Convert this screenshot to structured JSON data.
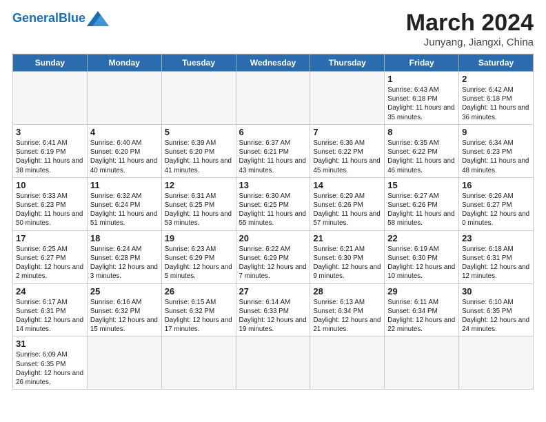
{
  "header": {
    "logo_general": "General",
    "logo_blue": "Blue",
    "month_title": "March 2024",
    "subtitle": "Junyang, Jiangxi, China"
  },
  "days_of_week": [
    "Sunday",
    "Monday",
    "Tuesday",
    "Wednesday",
    "Thursday",
    "Friday",
    "Saturday"
  ],
  "weeks": [
    [
      {
        "day": "",
        "info": ""
      },
      {
        "day": "",
        "info": ""
      },
      {
        "day": "",
        "info": ""
      },
      {
        "day": "",
        "info": ""
      },
      {
        "day": "",
        "info": ""
      },
      {
        "day": "1",
        "info": "Sunrise: 6:43 AM\nSunset: 6:18 PM\nDaylight: 11 hours and 35 minutes."
      },
      {
        "day": "2",
        "info": "Sunrise: 6:42 AM\nSunset: 6:18 PM\nDaylight: 11 hours and 36 minutes."
      }
    ],
    [
      {
        "day": "3",
        "info": "Sunrise: 6:41 AM\nSunset: 6:19 PM\nDaylight: 11 hours and 38 minutes."
      },
      {
        "day": "4",
        "info": "Sunrise: 6:40 AM\nSunset: 6:20 PM\nDaylight: 11 hours and 40 minutes."
      },
      {
        "day": "5",
        "info": "Sunrise: 6:39 AM\nSunset: 6:20 PM\nDaylight: 11 hours and 41 minutes."
      },
      {
        "day": "6",
        "info": "Sunrise: 6:37 AM\nSunset: 6:21 PM\nDaylight: 11 hours and 43 minutes."
      },
      {
        "day": "7",
        "info": "Sunrise: 6:36 AM\nSunset: 6:22 PM\nDaylight: 11 hours and 45 minutes."
      },
      {
        "day": "8",
        "info": "Sunrise: 6:35 AM\nSunset: 6:22 PM\nDaylight: 11 hours and 46 minutes."
      },
      {
        "day": "9",
        "info": "Sunrise: 6:34 AM\nSunset: 6:23 PM\nDaylight: 11 hours and 48 minutes."
      }
    ],
    [
      {
        "day": "10",
        "info": "Sunrise: 6:33 AM\nSunset: 6:23 PM\nDaylight: 11 hours and 50 minutes."
      },
      {
        "day": "11",
        "info": "Sunrise: 6:32 AM\nSunset: 6:24 PM\nDaylight: 11 hours and 51 minutes."
      },
      {
        "day": "12",
        "info": "Sunrise: 6:31 AM\nSunset: 6:25 PM\nDaylight: 11 hours and 53 minutes."
      },
      {
        "day": "13",
        "info": "Sunrise: 6:30 AM\nSunset: 6:25 PM\nDaylight: 11 hours and 55 minutes."
      },
      {
        "day": "14",
        "info": "Sunrise: 6:29 AM\nSunset: 6:26 PM\nDaylight: 11 hours and 57 minutes."
      },
      {
        "day": "15",
        "info": "Sunrise: 6:27 AM\nSunset: 6:26 PM\nDaylight: 11 hours and 58 minutes."
      },
      {
        "day": "16",
        "info": "Sunrise: 6:26 AM\nSunset: 6:27 PM\nDaylight: 12 hours and 0 minutes."
      }
    ],
    [
      {
        "day": "17",
        "info": "Sunrise: 6:25 AM\nSunset: 6:27 PM\nDaylight: 12 hours and 2 minutes."
      },
      {
        "day": "18",
        "info": "Sunrise: 6:24 AM\nSunset: 6:28 PM\nDaylight: 12 hours and 3 minutes."
      },
      {
        "day": "19",
        "info": "Sunrise: 6:23 AM\nSunset: 6:29 PM\nDaylight: 12 hours and 5 minutes."
      },
      {
        "day": "20",
        "info": "Sunrise: 6:22 AM\nSunset: 6:29 PM\nDaylight: 12 hours and 7 minutes."
      },
      {
        "day": "21",
        "info": "Sunrise: 6:21 AM\nSunset: 6:30 PM\nDaylight: 12 hours and 9 minutes."
      },
      {
        "day": "22",
        "info": "Sunrise: 6:19 AM\nSunset: 6:30 PM\nDaylight: 12 hours and 10 minutes."
      },
      {
        "day": "23",
        "info": "Sunrise: 6:18 AM\nSunset: 6:31 PM\nDaylight: 12 hours and 12 minutes."
      }
    ],
    [
      {
        "day": "24",
        "info": "Sunrise: 6:17 AM\nSunset: 6:31 PM\nDaylight: 12 hours and 14 minutes."
      },
      {
        "day": "25",
        "info": "Sunrise: 6:16 AM\nSunset: 6:32 PM\nDaylight: 12 hours and 15 minutes."
      },
      {
        "day": "26",
        "info": "Sunrise: 6:15 AM\nSunset: 6:32 PM\nDaylight: 12 hours and 17 minutes."
      },
      {
        "day": "27",
        "info": "Sunrise: 6:14 AM\nSunset: 6:33 PM\nDaylight: 12 hours and 19 minutes."
      },
      {
        "day": "28",
        "info": "Sunrise: 6:13 AM\nSunset: 6:34 PM\nDaylight: 12 hours and 21 minutes."
      },
      {
        "day": "29",
        "info": "Sunrise: 6:11 AM\nSunset: 6:34 PM\nDaylight: 12 hours and 22 minutes."
      },
      {
        "day": "30",
        "info": "Sunrise: 6:10 AM\nSunset: 6:35 PM\nDaylight: 12 hours and 24 minutes."
      }
    ],
    [
      {
        "day": "31",
        "info": "Sunrise: 6:09 AM\nSunset: 6:35 PM\nDaylight: 12 hours and 26 minutes."
      },
      {
        "day": "",
        "info": ""
      },
      {
        "day": "",
        "info": ""
      },
      {
        "day": "",
        "info": ""
      },
      {
        "day": "",
        "info": ""
      },
      {
        "day": "",
        "info": ""
      },
      {
        "day": "",
        "info": ""
      }
    ]
  ]
}
